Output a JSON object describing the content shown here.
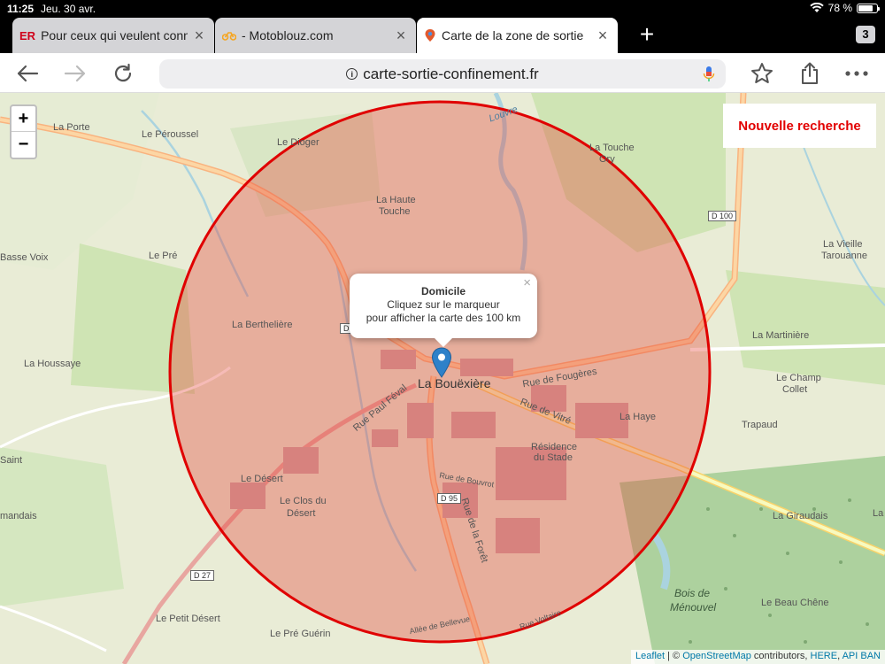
{
  "status": {
    "time": "11:25",
    "date": "Jeu. 30 avr.",
    "battery": "78 %",
    "battery_level": 0.78
  },
  "tabs": [
    {
      "favicon": "ER",
      "title": "Pour ceux qui veulent conn",
      "favicon_color": "#d0021b"
    },
    {
      "favicon": "motorbike-icon",
      "title": "- Motoblouz.com",
      "favicon_color": "#f5a623"
    },
    {
      "favicon": "map-pin-icon",
      "title": "Carte de la zone de sortie",
      "favicon_color": "#e25a2d"
    }
  ],
  "tab_count": "3",
  "url": "carte-sortie-confinement.fr",
  "map": {
    "zoom_in": "+",
    "zoom_out": "−",
    "new_search": "Nouvelle recherche",
    "popup": {
      "title": "Domicile",
      "line1": "Cliquez sur le marqueur",
      "line2": "pour afficher la carte des 100 km",
      "close": "×"
    },
    "circle_color": "#e00000",
    "labels": {
      "la_porte": "La Porte",
      "le_peroussel": "Le Péroussel",
      "le_dioger": "Le Dioger",
      "la_touche": "La Touche",
      "ory": "Ory",
      "la_haute": "La Haute",
      "touche": "Touche",
      "d100": "D 100",
      "basse_voix": "Basse Voix",
      "le_pre": "Le Pré",
      "la_vieille": "La Vieille",
      "tarouanne": "Tarouanne",
      "la_berthelière": "La Berthelière",
      "la_martinière": "La Martinière",
      "la_houssaye": "La Houssaye",
      "le_champ": "Le Champ",
      "collet": "Collet",
      "la_bouexiere": "La Bouëxière",
      "rue_fougeres": "Rue de Fougères",
      "rue_vitre": "Rue de Vitré",
      "la_haye": "La Haye",
      "trapaud": "Trapaud",
      "residence": "Résidence",
      "du_stade": "du Stade",
      "saint": "Saint",
      "le_desert": "Le Désert",
      "le_clos_du": "Le Clos du",
      "desert": "Désert",
      "mandais": "mandais",
      "d95": "D 95",
      "rue_foret": "Rue de la Forêt",
      "la_ribe": "La Rib",
      "la_giraudais": "La Giraudais",
      "d27": "D 27",
      "bois_de": "Bois de",
      "menouvel": "Ménouvel",
      "le_beau_chene": "Le Beau Chêne",
      "le_petit_desert": "Le Petit Désert",
      "le_pre_guerin": "Le Pré Guérin",
      "rue_paul_feval": "Rue Paul Féval",
      "rue_bouvrot": "Rue de Bouvrot",
      "allee_bellevue": "Allée de Bellevue",
      "rue_voltaire": "Rue Voltaire",
      "d": "D",
      "louvre": "Louvre"
    },
    "attribution": {
      "leaflet": "Leaflet",
      "sep": " | © ",
      "osm": "OpenStreetMap",
      "contrib": " contributors, ",
      "here": "HERE",
      "comma": ", ",
      "api": "API BAN"
    }
  }
}
